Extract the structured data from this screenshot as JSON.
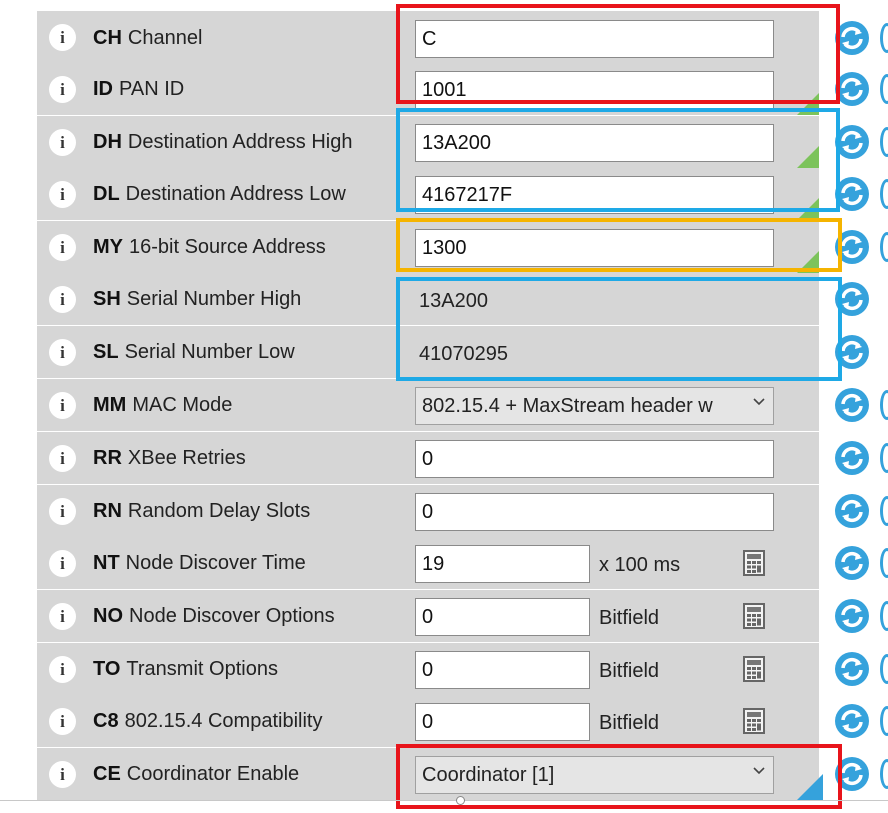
{
  "rows": [
    {
      "code": "CH",
      "name": "Channel",
      "control": "text",
      "value": "C",
      "status": "none"
    },
    {
      "code": "ID",
      "name": "PAN ID",
      "control": "text",
      "value": "1001",
      "status": "green"
    },
    {
      "code": "DH",
      "name": "Destination Address High",
      "control": "text",
      "value": "13A200",
      "status": "green"
    },
    {
      "code": "DL",
      "name": "Destination Address Low",
      "control": "text",
      "value": "4167217F",
      "status": "green"
    },
    {
      "code": "MY",
      "name": "16-bit Source Address",
      "control": "text",
      "value": "1300",
      "status": "green"
    },
    {
      "code": "SH",
      "name": "Serial Number High",
      "control": "readonly",
      "value": "13A200",
      "status": "none"
    },
    {
      "code": "SL",
      "name": "Serial Number Low",
      "control": "readonly",
      "value": "41070295",
      "status": "none"
    },
    {
      "code": "MM",
      "name": "MAC Mode",
      "control": "select",
      "value": "802.15.4 + MaxStream header w",
      "status": "none"
    },
    {
      "code": "RR",
      "name": "XBee Retries",
      "control": "text",
      "value": "0",
      "status": "none"
    },
    {
      "code": "RN",
      "name": "Random Delay Slots",
      "control": "text",
      "value": "0",
      "status": "none"
    },
    {
      "code": "NT",
      "name": "Node Discover Time",
      "control": "text-unit",
      "value": "19",
      "unit": "x 100 ms",
      "status": "none"
    },
    {
      "code": "NO",
      "name": "Node Discover Options",
      "control": "text-unit",
      "value": "0",
      "unit": "Bitfield",
      "status": "none"
    },
    {
      "code": "TO",
      "name": "Transmit Options",
      "control": "text-unit",
      "value": "0",
      "unit": "Bitfield",
      "status": "none"
    },
    {
      "code": "C8",
      "name": "802.15.4 Compatibility",
      "control": "text-unit",
      "value": "0",
      "unit": "Bitfield",
      "status": "none"
    },
    {
      "code": "CE",
      "name": "Coordinator Enable",
      "control": "select",
      "value": "Coordinator [1]",
      "status": "blue"
    }
  ],
  "info_glyph": "i",
  "icons": {
    "info": "info-icon",
    "refresh": "refresh-icon",
    "calculator": "calculator-icon",
    "dropdown": "chevron-down-icon"
  },
  "colors": {
    "row_bg": "#d6d6d6",
    "changed_marker": "#7cc35b",
    "default_marker": "#35a2dc",
    "refresh_icon": "#35a2dc",
    "highlight_red": "#e8141b",
    "highlight_blue": "#1ea9e6",
    "highlight_orange": "#f5b400"
  }
}
